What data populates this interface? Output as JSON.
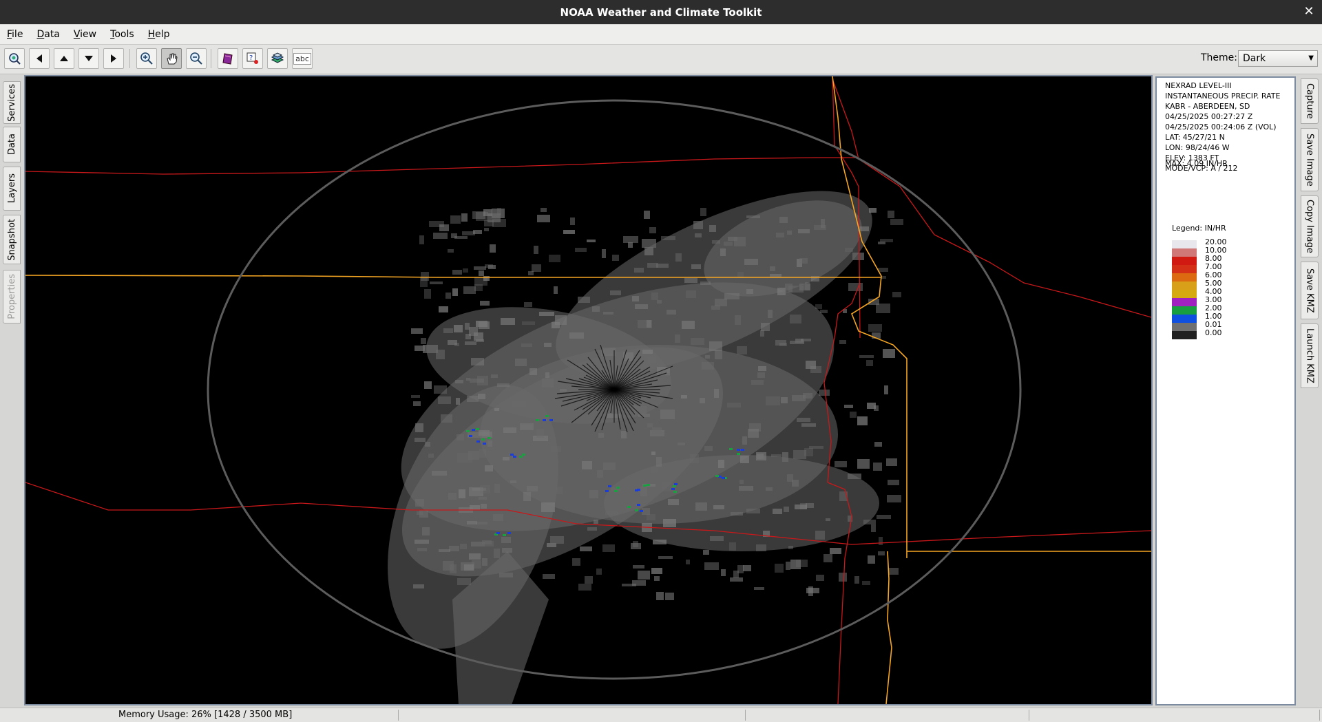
{
  "window": {
    "title": "NOAA Weather and Climate Toolkit",
    "close_glyph": "✕"
  },
  "menu": [
    {
      "mnemonic": "F",
      "rest": "ile"
    },
    {
      "mnemonic": "D",
      "rest": "ata"
    },
    {
      "mnemonic": "V",
      "rest": "iew"
    },
    {
      "mnemonic": "T",
      "rest": "ools"
    },
    {
      "mnemonic": "H",
      "rest": "elp"
    }
  ],
  "toolbar": {
    "buttons": [
      {
        "icon": "zoom-extent-icon"
      },
      {
        "icon": "pan-left-icon"
      },
      {
        "icon": "pan-up-icon"
      },
      {
        "icon": "pan-down-icon"
      },
      {
        "icon": "pan-right-icon"
      },
      {
        "icon": "zoom-in-icon"
      },
      {
        "icon": "pan-hand-icon",
        "active": true
      },
      {
        "icon": "zoom-out-icon"
      },
      {
        "icon": "bookmark-icon"
      },
      {
        "icon": "identify-icon"
      },
      {
        "icon": "layers-icon"
      },
      {
        "icon": "label-icon",
        "text": "abc"
      }
    ],
    "theme_label": "Theme:",
    "theme_value": "Dark"
  },
  "left_tabs": [
    {
      "label": "Services"
    },
    {
      "label": "Data"
    },
    {
      "label": "Layers"
    },
    {
      "label": "Snapshot"
    },
    {
      "label": "Properties",
      "disabled": true
    }
  ],
  "right_tabs": [
    {
      "label": "Capture"
    },
    {
      "label": "Save Image"
    },
    {
      "label": "Copy Image"
    },
    {
      "label": "Save KMZ"
    },
    {
      "label": "Launch KMZ"
    }
  ],
  "info": {
    "lines": [
      "NEXRAD LEVEL-III",
      "INSTANTANEOUS PRECIP. RATE",
      "KABR - ABERDEEN, SD",
      "04/25/2025 00:27:27 Z",
      "04/25/2025 00:24:06 Z (VOL)",
      "LAT: 45/27/21 N",
      "LON: 98/24/46 W",
      "ELEV: 1383 FT",
      "MODE/VCP: A / 212"
    ],
    "max": "MAX: 4.09 IN/HR"
  },
  "legend": {
    "title": "Legend:  IN/HR",
    "labels": [
      "20.00",
      "10.00",
      "8.00",
      "7.00",
      "6.00",
      "5.00",
      "4.00",
      "3.00",
      "2.00",
      "1.00",
      "0.01",
      "0.00"
    ],
    "colors": [
      "#e8e8ec",
      "#d07878",
      "#d01a12",
      "#d43018",
      "#dc6a10",
      "#d8a018",
      "#d4aa10",
      "#a020c0",
      "#18a040",
      "#1050e0",
      "#707070",
      "#202020"
    ]
  },
  "status": {
    "memory": "Memory Usage: 26% [1428 / 3500 MB]"
  },
  "map": {
    "colors": {
      "background": "#000000",
      "range_ring": "#5c5c5c",
      "state_border": "#f5a623",
      "county_border": "#c8181a",
      "echo_light": "#7a7a7a",
      "echo_mid": "#6a6a6a",
      "echo_heavy_blue": "#1a3cd8",
      "echo_heavy_green": "#1aa040"
    }
  }
}
